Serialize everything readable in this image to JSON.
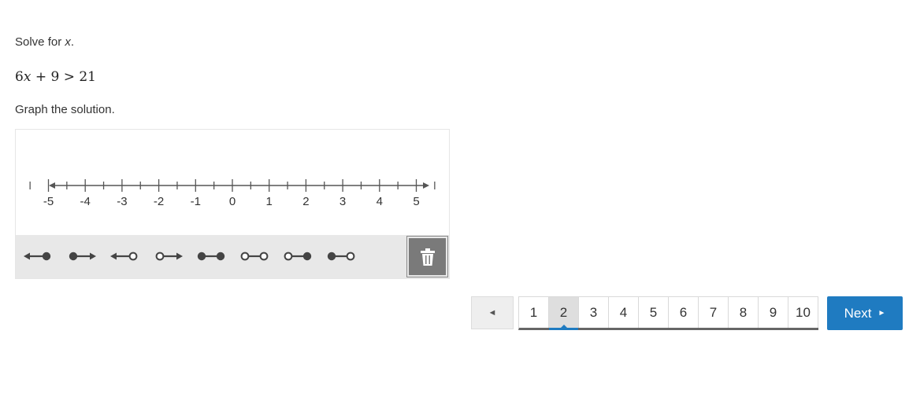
{
  "question": {
    "prompt_prefix": "Solve for ",
    "prompt_var": "x",
    "prompt_suffix": ".",
    "equation": {
      "coef": "6",
      "var": "x",
      "rest": " + 9 > 21"
    },
    "instruction": "Graph the solution."
  },
  "number_line": {
    "min": -5,
    "max": 5,
    "major_step": 1,
    "minor_step": 0.5,
    "labels": [
      "-5",
      "-4",
      "-3",
      "-2",
      "-1",
      "0",
      "1",
      "2",
      "3",
      "4",
      "5"
    ],
    "color": "#555555"
  },
  "tools": [
    {
      "name": "left-ray-closed-tool-icon"
    },
    {
      "name": "right-ray-closed-tool-icon"
    },
    {
      "name": "left-ray-open-tool-icon"
    },
    {
      "name": "right-ray-open-tool-icon"
    },
    {
      "name": "segment-closed-closed-tool-icon"
    },
    {
      "name": "segment-open-open-tool-icon"
    },
    {
      "name": "segment-open-closed-tool-icon"
    },
    {
      "name": "segment-closed-open-tool-icon"
    }
  ],
  "trash_icon": "trash-icon",
  "pagination": {
    "prev_label": "◄",
    "pages": [
      "1",
      "2",
      "3",
      "4",
      "5",
      "6",
      "7",
      "8",
      "9",
      "10"
    ],
    "current_page": "2",
    "next_label": "Next",
    "next_arrow": "►"
  },
  "colors": {
    "accent": "#1f7bc1",
    "tool_dark": "#444444",
    "toolbar_bg": "#e8e8e8"
  }
}
